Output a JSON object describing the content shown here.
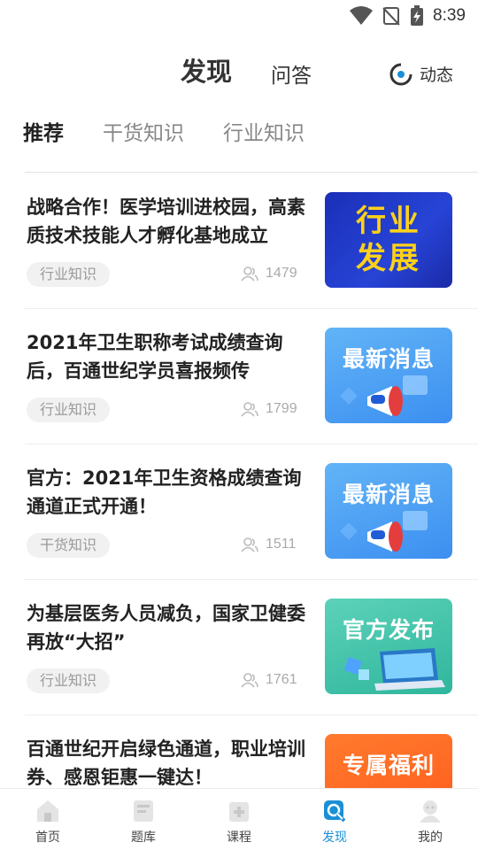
{
  "status_bar": {
    "time": "8:39"
  },
  "header": {
    "tabs": [
      {
        "label": "发现"
      },
      {
        "label": "问答"
      }
    ],
    "dynamic_label": "动态"
  },
  "subtabs": [
    {
      "label": "推荐"
    },
    {
      "label": "干货知识"
    },
    {
      "label": "行业知识"
    }
  ],
  "feed": [
    {
      "title": "战略合作！医学培训进校园，高素质技术技能人才孵化基地成立",
      "tag": "行业知识",
      "views": "1479",
      "thumb_text": "行业发展",
      "thumb_line1": "行业",
      "thumb_line2": "发展"
    },
    {
      "title": "2021年卫生职称考试成绩查询后，百通世纪学员喜报频传",
      "tag": "行业知识",
      "views": "1799",
      "thumb_text": "最新消息"
    },
    {
      "title": "官方：2021年卫生资格成绩查询通道正式开通！",
      "tag": "干货知识",
      "views": "1511",
      "thumb_text": "最新消息"
    },
    {
      "title": "为基层医务人员减负，国家卫健委再放“大招”",
      "tag": "行业知识",
      "views": "1761",
      "thumb_text": "官方发布"
    },
    {
      "title": "百通世纪开启绿色通道，职业培训券、感恩钜惠一键达！",
      "thumb_text": "专属福利"
    }
  ],
  "bottom_nav": [
    {
      "label": "首页",
      "icon": "home-icon"
    },
    {
      "label": "题库",
      "icon": "question-bank-icon"
    },
    {
      "label": "课程",
      "icon": "course-icon"
    },
    {
      "label": "发现",
      "icon": "discover-icon"
    },
    {
      "label": "我的",
      "icon": "profile-icon"
    }
  ],
  "colors": {
    "accent": "#1a8fd6",
    "tag_bg": "#f1f1f1"
  }
}
